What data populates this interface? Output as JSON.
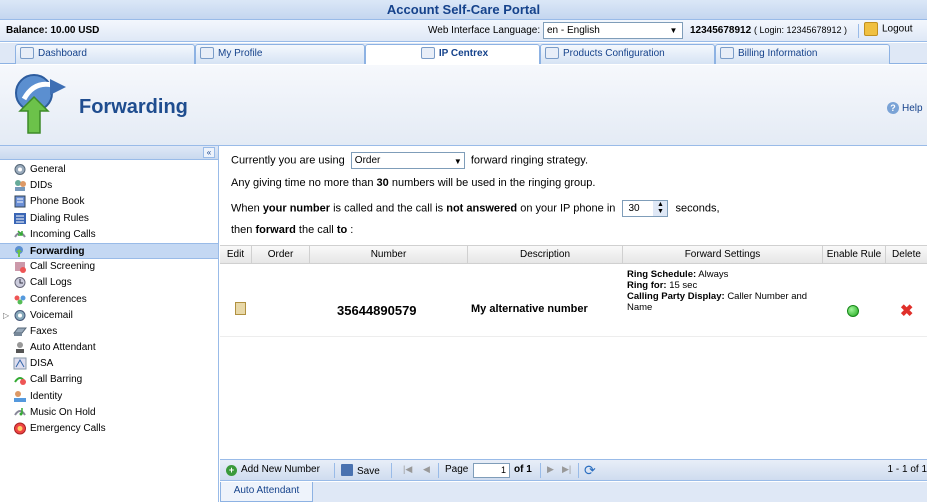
{
  "portal": {
    "title": "Account Self-Care Portal"
  },
  "infobar": {
    "balance_label": "Balance:",
    "balance_value": "10.00 USD",
    "language_label": "Web Interface Language:",
    "language_value": "en - English",
    "account_number": "12345678912",
    "login_text": "( Login: 12345678912 )",
    "logout_label": "Logout"
  },
  "tabs": [
    {
      "label": "Dashboard"
    },
    {
      "label": "My Profile"
    },
    {
      "label": "IP Centrex"
    },
    {
      "label": "Products Configuration"
    },
    {
      "label": "Billing Information"
    }
  ],
  "page": {
    "title": "Forwarding",
    "help_label": "Help"
  },
  "sidebar": {
    "collapse_glyph": "«",
    "items": [
      {
        "label": "General"
      },
      {
        "label": "DIDs"
      },
      {
        "label": "Phone Book"
      },
      {
        "label": "Dialing Rules"
      },
      {
        "label": "Incoming Calls"
      },
      {
        "label": "Forwarding"
      },
      {
        "label": "Call Screening"
      },
      {
        "label": "Call Logs"
      },
      {
        "label": "Conferences"
      },
      {
        "label": "Voicemail"
      },
      {
        "label": "Faxes"
      },
      {
        "label": "Auto Attendant"
      },
      {
        "label": "DISA"
      },
      {
        "label": "Call Barring"
      },
      {
        "label": "Identity"
      },
      {
        "label": "Music On Hold"
      },
      {
        "label": "Emergency Calls"
      }
    ]
  },
  "content": {
    "strategy_prefix": "Currently you are using",
    "strategy_value": "Order",
    "strategy_suffix": "forward ringing strategy.",
    "limit_prefix": "Any giving time no more than",
    "limit_value": "30",
    "limit_suffix": "numbers will be used in the ringing group.",
    "when_1": "When",
    "when_bold_1": "your number",
    "when_2": "is called and the call is",
    "when_bold_2": "not answered",
    "when_3": "on your IP phone in",
    "seconds_value": "30",
    "seconds_suffix": "seconds,",
    "then_1": "then",
    "then_bold_1": "forward",
    "then_2": "the call",
    "then_bold_2": "to",
    "then_3": ":"
  },
  "grid": {
    "columns": [
      "Edit",
      "Order",
      "Number",
      "Description",
      "Forward Settings",
      "Enable Rule",
      "Delete"
    ],
    "rows": [
      {
        "number": "35644890579",
        "description": "My alternative number",
        "ring_schedule_label": "Ring Schedule:",
        "ring_schedule_value": "Always",
        "ring_for_label": "Ring for:",
        "ring_for_value": "15 sec",
        "calling_party_label": "Calling Party Display:",
        "calling_party_value": "Caller Number and Name",
        "enabled": true
      }
    ]
  },
  "toolbar": {
    "add_label": "Add New Number",
    "save_label": "Save",
    "page_label": "Page",
    "page_value": "1",
    "page_of": "of 1",
    "summary": "1 - 1 of 1"
  },
  "bottom_tabs": [
    {
      "label": "Auto Attendant"
    }
  ],
  "colors": {
    "accent": "#15428b",
    "enabled": "#1ea81a",
    "delete": "#e0302a"
  }
}
